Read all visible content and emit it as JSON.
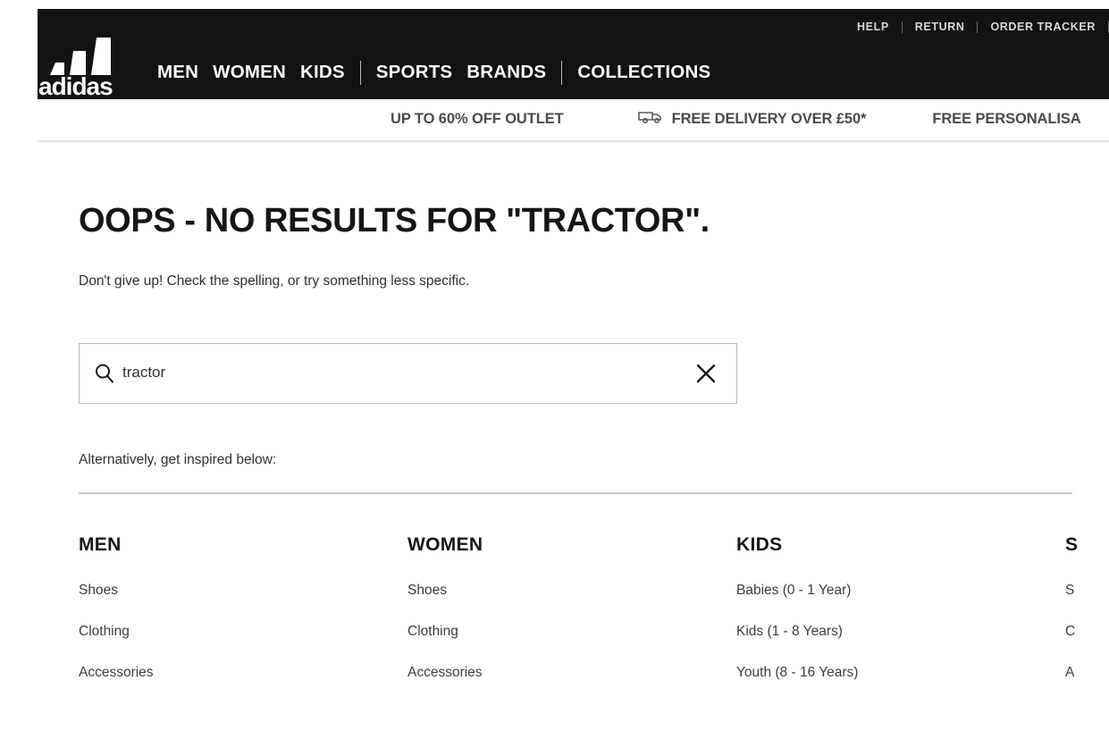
{
  "header": {
    "logo_alt": "adidas",
    "utility_nav": [
      {
        "label": "HELP"
      },
      {
        "label": "RETURN"
      },
      {
        "label": "ORDER TRACKER"
      }
    ],
    "main_nav": [
      {
        "label": "MEN"
      },
      {
        "label": "WOMEN"
      },
      {
        "label": "KIDS"
      },
      {
        "label": "SPORTS"
      },
      {
        "label": "BRANDS"
      },
      {
        "label": "COLLECTIONS"
      }
    ],
    "background_color": "#121215"
  },
  "promo_banner": {
    "items": [
      {
        "label": "UP TO 60% OFF OUTLET",
        "icon": ""
      },
      {
        "label": "FREE DELIVERY OVER £50*",
        "icon": "delivery-truck-icon"
      },
      {
        "label": "FREE PERSONALISA",
        "icon": ""
      }
    ]
  },
  "main": {
    "headline": "OOPS - NO RESULTS FOR \"TRACTOR\".",
    "subtext": "Don't give up! Check the spelling, or try something less specific.",
    "alternative_text": "Alternatively, get inspired below:"
  },
  "search": {
    "value": "tractor",
    "placeholder": "Search",
    "icon": "search-icon",
    "clear_icon": "close-icon"
  },
  "categories": [
    {
      "title": "MEN",
      "links": [
        "Shoes",
        "Clothing",
        "Accessories"
      ]
    },
    {
      "title": "WOMEN",
      "links": [
        "Shoes",
        "Clothing",
        "Accessories"
      ]
    },
    {
      "title": "KIDS",
      "links": [
        "Babies (0 - 1 Year)",
        "Kids (1 - 8 Years)",
        "Youth (8 - 16 Years)"
      ]
    },
    {
      "title": "S",
      "links": [
        "S",
        "C",
        "A"
      ]
    }
  ],
  "colors": {
    "header_bg": "#121215",
    "text_primary": "#16161a",
    "text_secondary": "#3d3d3d",
    "border": "#b8b8b8",
    "divider": "#c9c9c9"
  }
}
